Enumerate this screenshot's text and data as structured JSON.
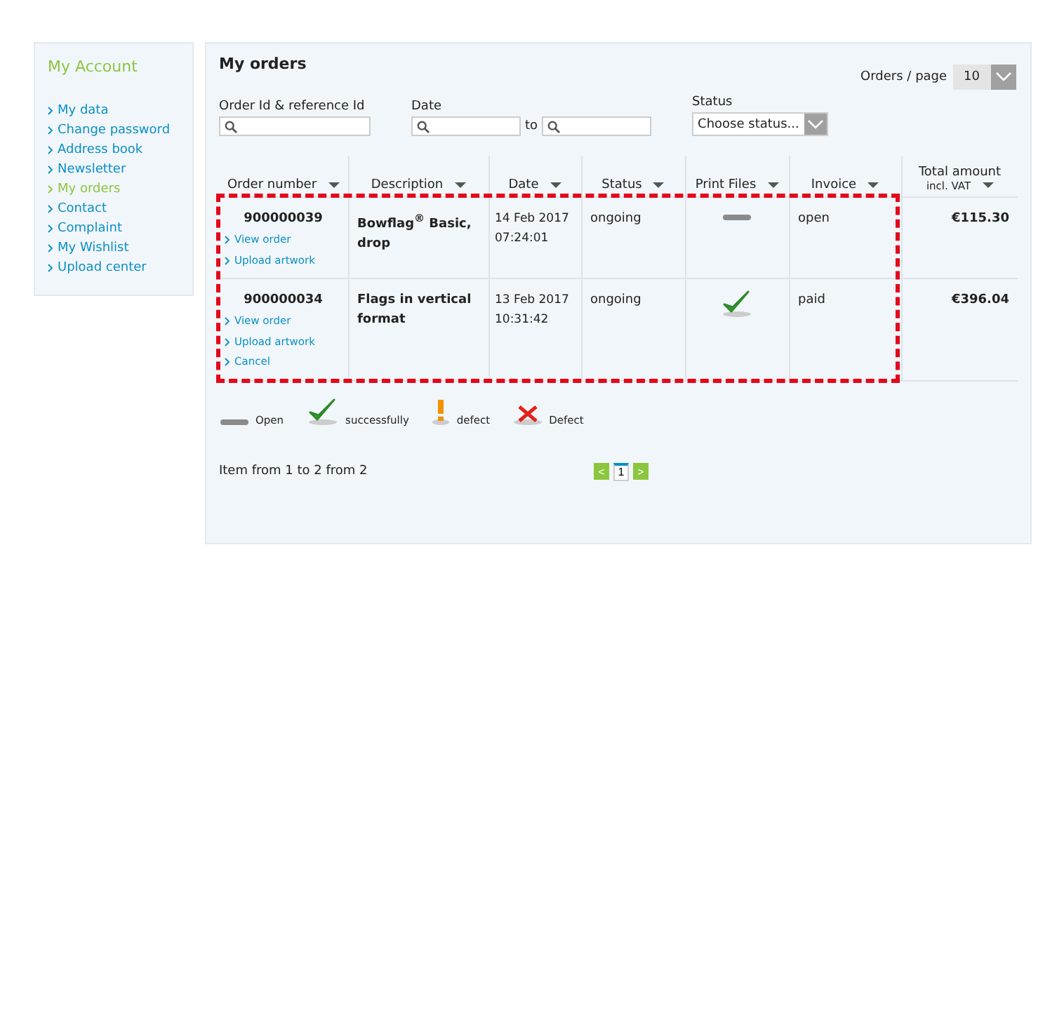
{
  "sidebar": {
    "title": "My Account",
    "items": [
      {
        "label": "My data",
        "selected": false
      },
      {
        "label": "Change password",
        "selected": false
      },
      {
        "label": "Address book",
        "selected": false
      },
      {
        "label": "Newsletter",
        "selected": false
      },
      {
        "label": "My orders",
        "selected": true
      },
      {
        "label": "Contact",
        "selected": false
      },
      {
        "label": "Complaint",
        "selected": false
      },
      {
        "label": "My Wishlist",
        "selected": false
      },
      {
        "label": "Upload center",
        "selected": false
      }
    ]
  },
  "orders": {
    "title": "My orders",
    "per_page": {
      "label": "Orders / page",
      "value": "10"
    },
    "filters": {
      "order_id": {
        "label": "Order Id & reference Id"
      },
      "date": {
        "label": "Date",
        "separator": "to"
      },
      "status": {
        "label": "Status",
        "value": "Choose status..."
      }
    },
    "columns": [
      {
        "label": "Order number"
      },
      {
        "label": "Description"
      },
      {
        "label": "Date"
      },
      {
        "label": "Status"
      },
      {
        "label": "Print Files"
      },
      {
        "label": "Invoice"
      },
      {
        "label": "Total amount",
        "sublabel": "incl. VAT"
      }
    ],
    "rows": [
      {
        "order_number": "900000039",
        "links": [
          "View order",
          "Upload artwork"
        ],
        "description": "Bowflag$^{®}$ Basic, drop",
        "date": "14 Feb 2017",
        "time": "07:24:01",
        "status": "ongoing",
        "print_files": {
          "kind": "open"
        },
        "invoice": "open",
        "total": "€115.30"
      },
      {
        "order_number": "900000034",
        "links": [
          "View order",
          "Upload artwork",
          "Cancel"
        ],
        "description": "Flags in vertical format",
        "date": "13 Feb 2017",
        "time": "10:31:42",
        "status": "ongoing",
        "print_files": {
          "kind": "success"
        },
        "invoice": "paid",
        "total": "€396.04"
      }
    ],
    "annotation": {
      "kind": "dashed-frame"
    },
    "legend": [
      {
        "kind": "open",
        "label": "Open"
      },
      {
        "kind": "success",
        "label": "successfully"
      },
      {
        "kind": "warning",
        "label": "defect"
      },
      {
        "kind": "error",
        "label": "Defect"
      }
    ],
    "footer": {
      "summary": "Item from 1 to 2 from 2",
      "prev": "<",
      "pages": [
        {
          "label": "1",
          "selected": true
        }
      ],
      "next": ">"
    }
  }
}
